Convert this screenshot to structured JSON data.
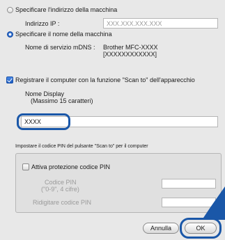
{
  "machine_address": {
    "option_label": "Specificare l'indirizzo della macchina",
    "ip_label": "Indirizzo IP :",
    "ip_placeholder": "XXX.XXX.XXX.XXX"
  },
  "machine_name": {
    "option_label": "Specificare il nome della macchina",
    "service_label": "Nome di servizio mDNS :",
    "service_value_line1": "Brother MFC-XXXX",
    "service_value_line2": "[XXXXXXXXXXXX]"
  },
  "register": {
    "checkbox_label": "Registrare il computer con la funzione \"Scan to\" dell'apparecchio",
    "display_name_label": "Nome Display",
    "display_name_hint": "(Massimo 15 caratteri)",
    "display_name_value": "XXXX"
  },
  "pin": {
    "section_title": "Impostare il codice PIN del pulsante \"Scan to\" per il computer",
    "protection_label": "Attiva protezione codice PIN",
    "code_label": "Codice PIN",
    "code_hint": "(\"0-9\", 4 cifre)",
    "confirm_label": "Ridigitare codice PIN"
  },
  "buttons": {
    "cancel": "Annulla",
    "ok": "OK"
  },
  "colors": {
    "highlight": "#1a57a8",
    "arrow": "#1a57a8"
  }
}
